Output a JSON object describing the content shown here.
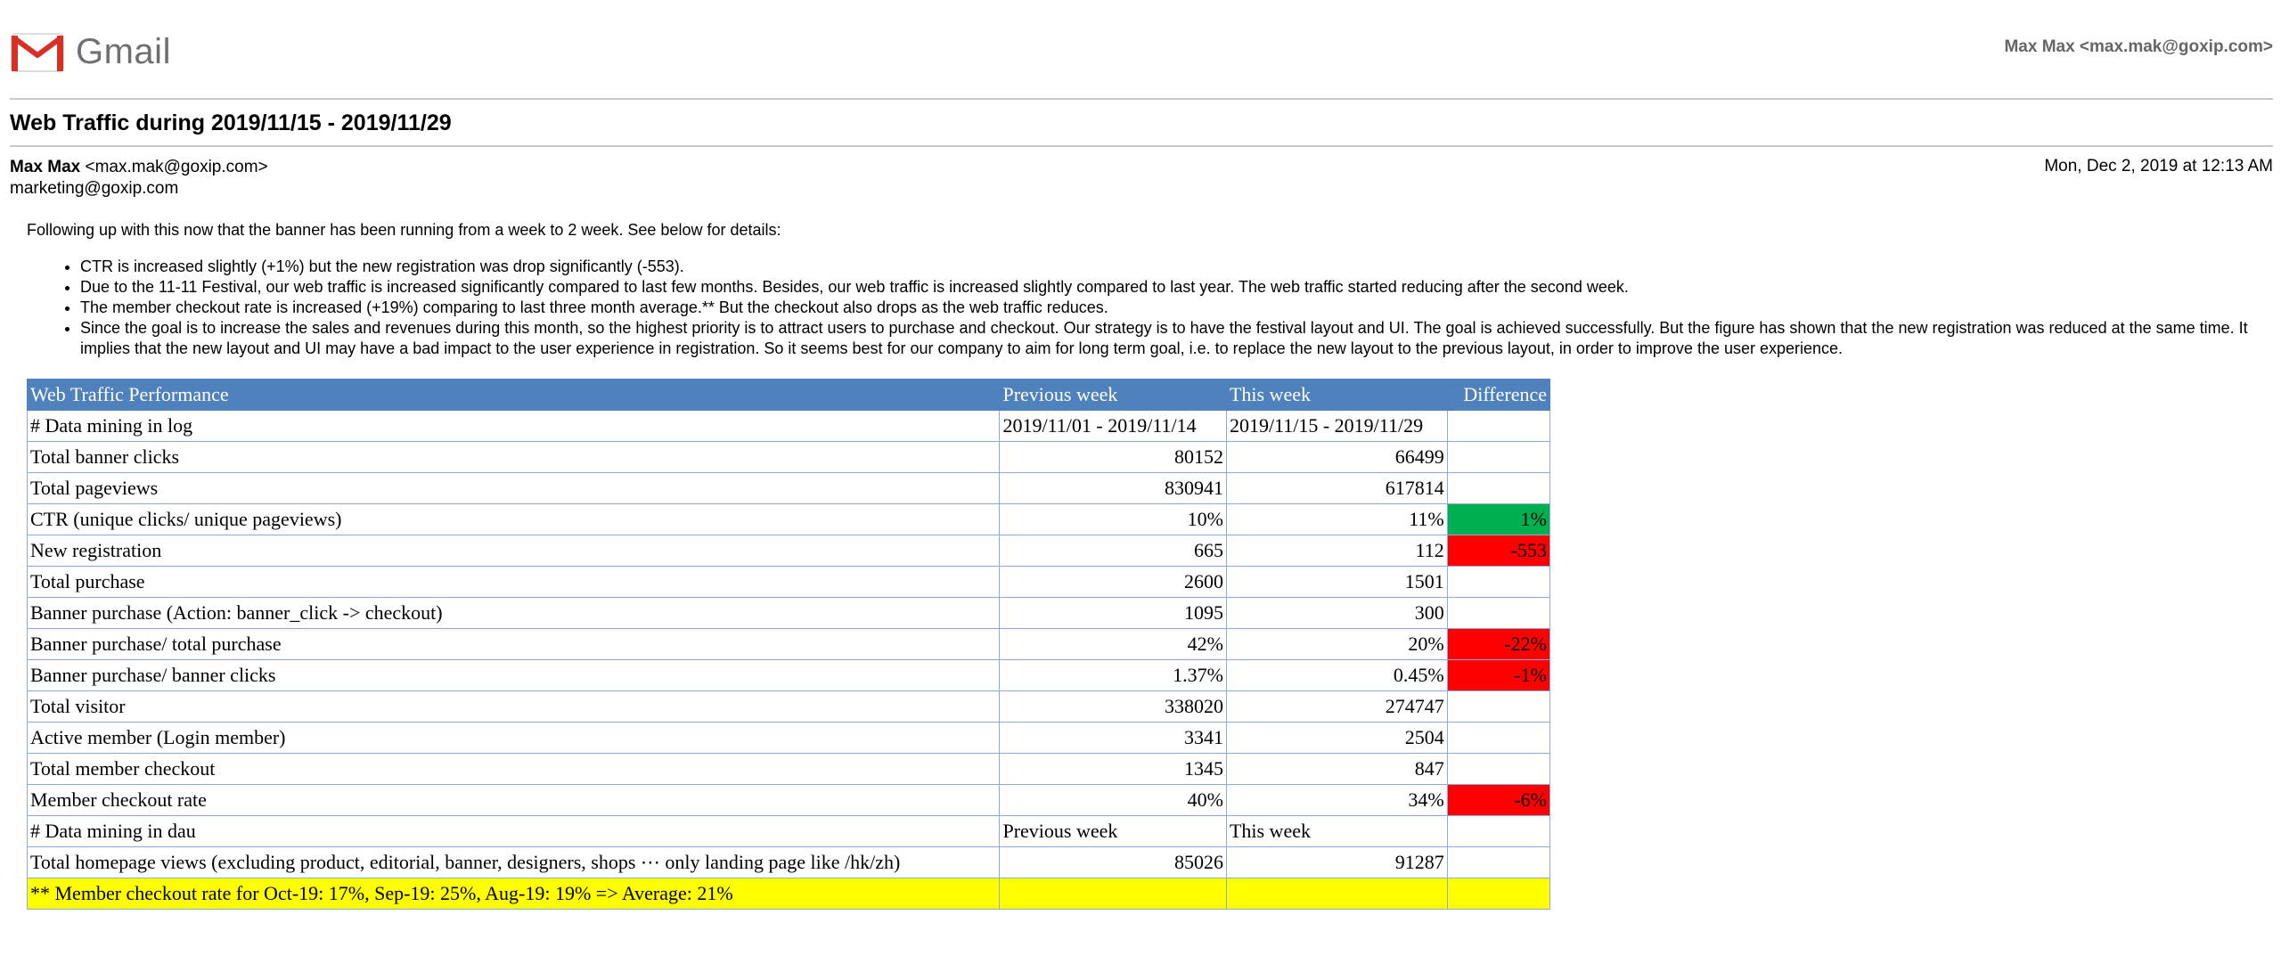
{
  "app": {
    "name": "Gmail",
    "account": "Max Max <max.mak@goxip.com>"
  },
  "email": {
    "subject": "Web Traffic during 2019/11/15 - 2019/11/29",
    "from_name": "Max Max",
    "from_email": "<max.mak@goxip.com>",
    "to": "marketing@goxip.com",
    "date": "Mon, Dec 2, 2019 at 12:13 AM",
    "intro": "Following up with this now that the banner has been running from a week to 2 week. See below for details:",
    "bullets": [
      "CTR is increased slightly (+1%) but the new registration was drop significantly (-553).",
      "Due to the 11-11 Festival, our web traffic is increased significantly compared to last few months. Besides, our web traffic is increased slightly compared to last year. The web traffic started reducing after the second week.",
      "The member checkout rate is increased (+19%) comparing to last three month average.** But the checkout also drops as the web traffic reduces.",
      "Since the goal is to increase the sales and revenues during this month, so the highest priority is to attract users to purchase and checkout. Our strategy is to have the festival layout and UI. The goal is achieved successfully. But the figure has shown that the new registration was reduced at the same time. It implies that the new layout and UI may have a bad impact to the user experience in registration. So it seems best for our company to aim for long term goal, i.e. to replace the new layout to the previous layout, in order to improve the user experience."
    ]
  },
  "table": {
    "header": [
      "Web Traffic Performance",
      "Previous week",
      "This week",
      "Difference"
    ],
    "rows": [
      [
        "# Data mining in log",
        "2019/11/01 - 2019/11/14",
        "2019/11/15 - 2019/11/29",
        ""
      ],
      [
        "Total banner clicks",
        "80152",
        "66499",
        ""
      ],
      [
        "Total pageviews",
        "830941",
        "617814",
        ""
      ],
      [
        "CTR (unique clicks/ unique pageviews)",
        "10%",
        "11%",
        "1%"
      ],
      [
        "New registration",
        "665",
        "112",
        "-553"
      ],
      [
        "Total purchase",
        "2600",
        "1501",
        ""
      ],
      [
        "Banner purchase (Action: banner_click -> checkout)",
        "1095",
        "300",
        ""
      ],
      [
        "Banner purchase/ total purchase",
        "42%",
        "20%",
        "-22%"
      ],
      [
        "Banner purchase/ banner clicks",
        "1.37%",
        "0.45%",
        "-1%"
      ],
      [
        "Total visitor",
        "338020",
        "274747",
        ""
      ],
      [
        "Active member (Login member)",
        "3341",
        "2504",
        ""
      ],
      [
        "Total member checkout",
        "1345",
        "847",
        ""
      ],
      [
        "Member checkout rate",
        "40%",
        "34%",
        "-6%"
      ],
      [
        "# Data mining in dau",
        "Previous week",
        "This week",
        ""
      ],
      [
        "Total homepage views (excluding product, editorial, banner, designers, shops ⋯ only landing page like /hk/zh)",
        "85026",
        "91287",
        ""
      ]
    ],
    "note": "** Member checkout rate for Oct-19: 17%, Sep-19: 25%, Aug-19: 19% => Average: 21%",
    "colors": {
      "header": "#4f81bd",
      "positive": "#00b050",
      "negative": "#ff0000",
      "note": "#ffff00"
    }
  }
}
